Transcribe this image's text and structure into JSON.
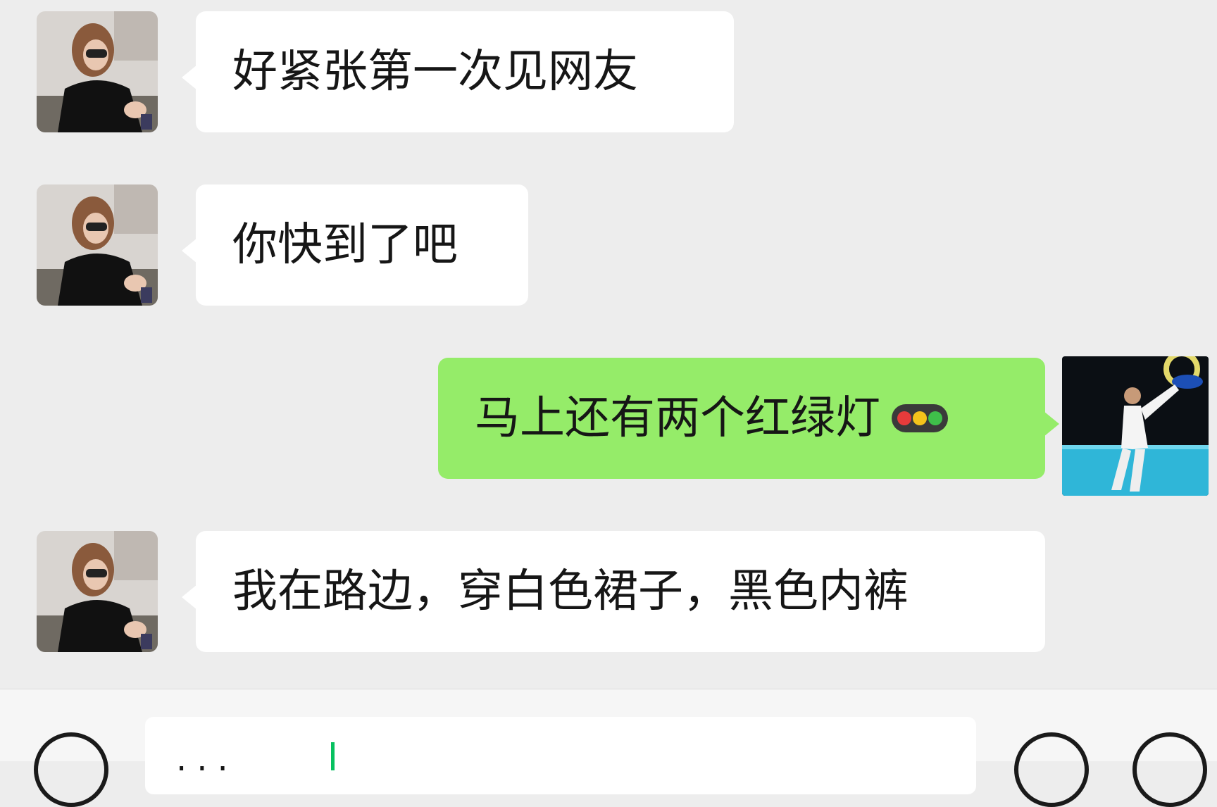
{
  "messages": [
    {
      "direction": "incoming",
      "text": "好紧张第一次见网友",
      "avatar": "female-contact-avatar"
    },
    {
      "direction": "incoming",
      "text": "你快到了吧",
      "avatar": "female-contact-avatar"
    },
    {
      "direction": "outgoing",
      "text": "马上还有两个红绿灯",
      "emoji": "traffic-light-emoji",
      "avatar": "male-self-avatar"
    },
    {
      "direction": "incoming",
      "text": "我在路边，穿白色裙子，黑色内裤",
      "avatar": "female-contact-avatar"
    }
  ],
  "input_bar": {
    "draft_text": "...",
    "left_icon": "voice-icon",
    "right_icons": [
      "emoji-icon",
      "plus-icon"
    ]
  },
  "colors": {
    "background": "#ededed",
    "incoming_bubble": "#ffffff",
    "outgoing_bubble": "#95ec69",
    "caret": "#07c160"
  }
}
